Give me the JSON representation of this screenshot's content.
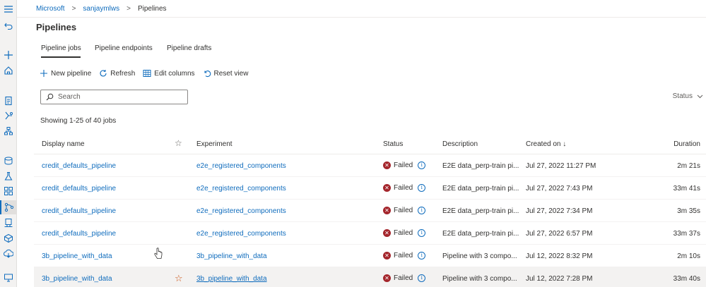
{
  "breadcrumb": {
    "root": "Microsoft",
    "workspace": "sanjaymlws",
    "current": "Pipelines",
    "sep": ">"
  },
  "page": {
    "title": "Pipelines"
  },
  "tabs": [
    {
      "label": "Pipeline jobs",
      "active": true
    },
    {
      "label": "Pipeline endpoints",
      "active": false
    },
    {
      "label": "Pipeline drafts",
      "active": false
    }
  ],
  "toolbar": {
    "new_pipeline": "New pipeline",
    "refresh": "Refresh",
    "edit_columns": "Edit columns",
    "reset_view": "Reset view"
  },
  "search": {
    "placeholder": "Search",
    "value": ""
  },
  "status_filter": {
    "label": "Status"
  },
  "summary": {
    "showing": "Showing 1-25 of 40 jobs"
  },
  "table": {
    "headers": {
      "display_name": "Display name",
      "experiment": "Experiment",
      "status": "Status",
      "description": "Description",
      "created_on": "Created on ↓",
      "duration": "Duration"
    },
    "rows": [
      {
        "name": "credit_defaults_pipeline",
        "experiment": "e2e_registered_components",
        "status": "Failed",
        "description": "E2E data_perp-train pi...",
        "created": "Jul 27, 2022 11:27 PM",
        "duration": "2m 21s"
      },
      {
        "name": "credit_defaults_pipeline",
        "experiment": "e2e_registered_components",
        "status": "Failed",
        "description": "E2E data_perp-train pi...",
        "created": "Jul 27, 2022 7:43 PM",
        "duration": "33m 41s"
      },
      {
        "name": "credit_defaults_pipeline",
        "experiment": "e2e_registered_components",
        "status": "Failed",
        "description": "E2E data_perp-train pi...",
        "created": "Jul 27, 2022 7:34 PM",
        "duration": "3m 35s"
      },
      {
        "name": "credit_defaults_pipeline",
        "experiment": "e2e_registered_components",
        "status": "Failed",
        "description": "E2E data_perp-train pi...",
        "created": "Jul 27, 2022 6:57 PM",
        "duration": "33m 37s"
      },
      {
        "name": "3b_pipeline_with_data",
        "experiment": "3b_pipeline_with_data",
        "status": "Failed",
        "description": "Pipeline with 3 compo...",
        "created": "Jul 12, 2022 8:32 PM",
        "duration": "2m 10s"
      },
      {
        "name": "3b_pipeline_with_data",
        "experiment": "3b_pipeline_with_data",
        "status": "Failed",
        "description": "Pipeline with 3 compo...",
        "created": "Jul 12, 2022 7:28 PM",
        "duration": "33m 40s"
      }
    ]
  },
  "colors": {
    "accent": "#0f6cbd",
    "failed": "#a4262c",
    "star": "#ca5010"
  }
}
